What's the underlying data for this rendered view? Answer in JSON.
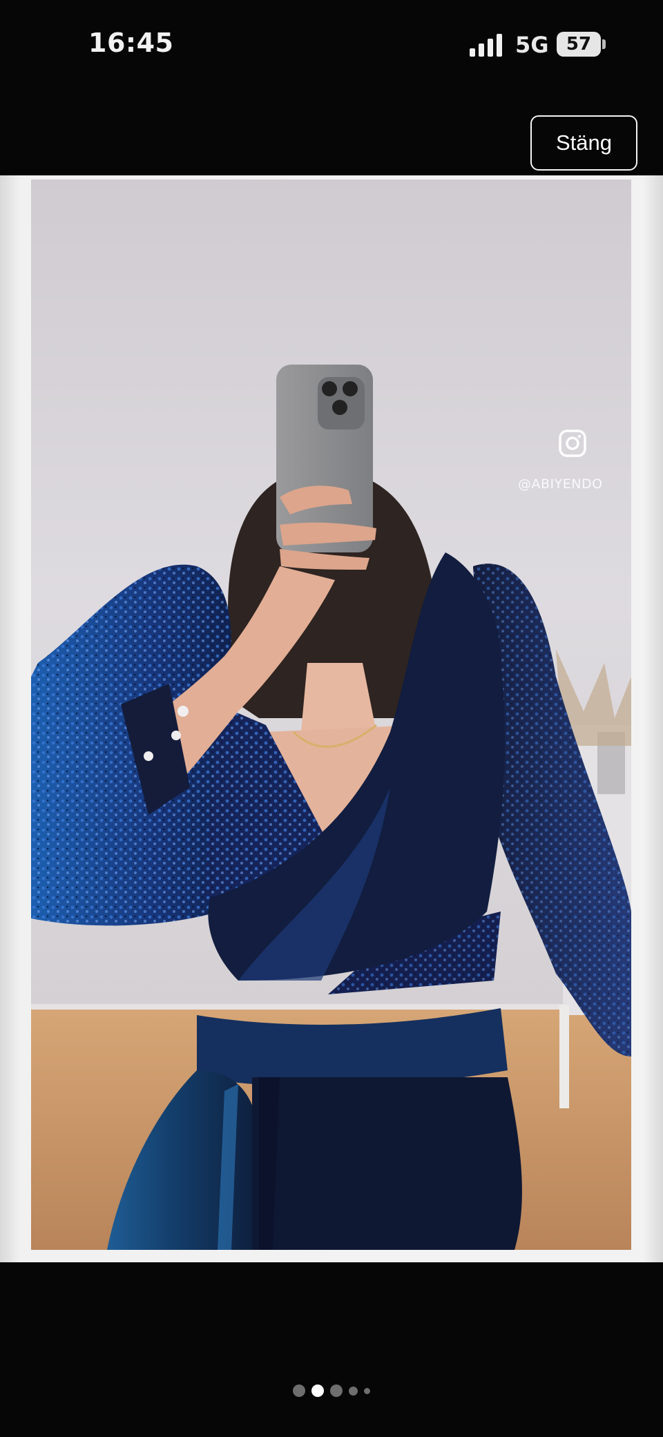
{
  "status_bar": {
    "time": "16:45",
    "network": "5G",
    "battery": "57"
  },
  "header": {
    "close_label": "Stäng"
  },
  "photo": {
    "watermark_icon": "instagram-icon",
    "watermark_text": "@ABIYENDO"
  },
  "pager": {
    "count": 5,
    "active_index": 1
  },
  "colors": {
    "background": "#060606",
    "viewer_frame": "#f2f2f2",
    "dress_navy": "#0f1a3a",
    "sequin_blue": "#1d4fa0",
    "wall": "#d9d6da",
    "floor": "#c99564"
  }
}
